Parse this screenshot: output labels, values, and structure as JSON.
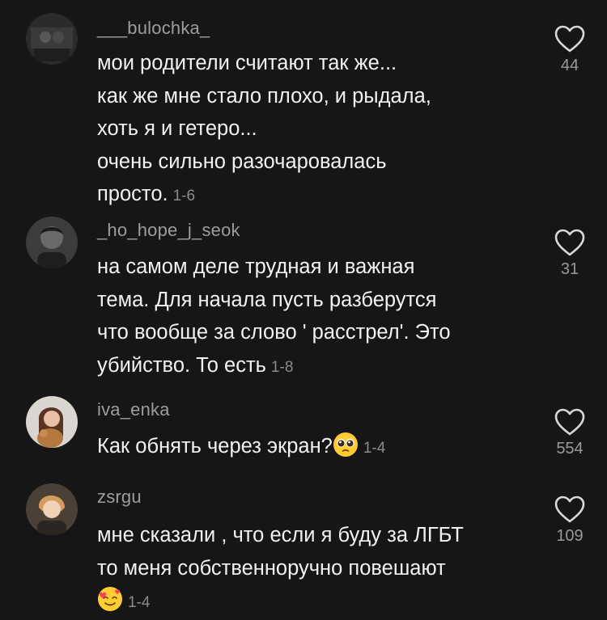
{
  "comments": [
    {
      "username": "___bulochka_",
      "lines": [
        "мои родители считают так же...",
        "как же мне стало плохо, и рыдала,",
        "хоть я и гетеро...",
        "очень сильно разочаровалась",
        "просто."
      ],
      "meta": "1-6",
      "likes": "44",
      "avatar": "user-avatar-dark-photo"
    },
    {
      "username": "_ho_hope_j_seok",
      "lines": [
        "на самом деле трудная и важная",
        "тема. Для начала пусть разберутся",
        "что вообще за слово ' расстрел'. Это",
        "убийство. То есть"
      ],
      "meta": "1-8",
      "likes": "31",
      "avatar": "user-avatar-portrait"
    },
    {
      "username": "iva_enka",
      "lines": [
        "Как обнять через экран?"
      ],
      "emoji": "pleading-face-emoji",
      "meta": "1-4",
      "likes": "554",
      "avatar": "user-avatar-girl-with-cat"
    },
    {
      "username": "zsrgu",
      "lines": [
        "мне сказали , что если я буду за ЛГБТ",
        "то меня собственноручно повешают"
      ],
      "emoji": "smiling-face-with-hearts-emoji",
      "meta": "1-4",
      "likes": "109",
      "avatar": "user-avatar-redhead"
    }
  ],
  "icons": {
    "like": "heart-outline-icon"
  },
  "colors": {
    "background": "#161616",
    "text": "#f2f2f2",
    "secondary": "#9d9d9d"
  }
}
